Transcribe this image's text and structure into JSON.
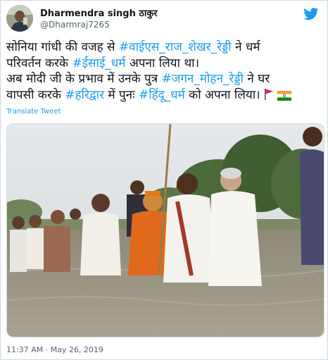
{
  "author": {
    "display_name": "Dharmendra singh ठाकुर",
    "handle": "@Dharmraj7265"
  },
  "logo_icon": "twitter-bird-icon",
  "tweet": {
    "line1_a": "सोनिया गांधी की वजह से ",
    "line1_tag": "#वाईएस_राज_शेखर_रेड्डी",
    "line1_b": " ने धर्म",
    "line2_a": "परिवर्तन करके ",
    "line2_tag": "#ईसाई_धर्म",
    "line2_b": " अपना लिया था।",
    "line3_a": "अब मोदी जी के प्रभाव में उनके पुत्र ",
    "line3_tag": "#जगन_मोहन_रेड्डी",
    "line3_b": " ने घर",
    "line4_a": "वापसी करके ",
    "line4_tag1": "#हरिद्वार",
    "line4_b": " में पुनः ",
    "line4_tag2": "#हिंदू_धर्म",
    "line4_c": " को अपना लिया।",
    "emojis": [
      "red-flag-icon",
      "india-flag-icon"
    ]
  },
  "translate_label": "Translate Tweet",
  "media": {
    "image": "photo of men standing waist-deep in river water"
  },
  "timestamp": "11:37 AM · May 26, 2019",
  "colors": {
    "link": "#1d9bf0",
    "text": "#0f1419",
    "secondary": "#536471",
    "border": "#cfd9de"
  }
}
